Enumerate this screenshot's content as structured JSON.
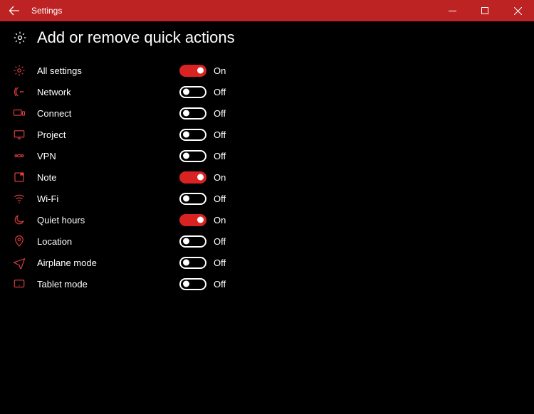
{
  "window": {
    "title": "Settings"
  },
  "page": {
    "title": "Add or remove quick actions"
  },
  "labels": {
    "on": "On",
    "off": "Off"
  },
  "actions": [
    {
      "id": "all-settings",
      "label": "All settings",
      "on": true
    },
    {
      "id": "network",
      "label": "Network",
      "on": false
    },
    {
      "id": "connect",
      "label": "Connect",
      "on": false
    },
    {
      "id": "project",
      "label": "Project",
      "on": false
    },
    {
      "id": "vpn",
      "label": "VPN",
      "on": false
    },
    {
      "id": "note",
      "label": "Note",
      "on": true
    },
    {
      "id": "wifi",
      "label": "Wi-Fi",
      "on": false
    },
    {
      "id": "quiet-hours",
      "label": "Quiet hours",
      "on": true
    },
    {
      "id": "location",
      "label": "Location",
      "on": false
    },
    {
      "id": "airplane-mode",
      "label": "Airplane mode",
      "on": false
    },
    {
      "id": "tablet-mode",
      "label": "Tablet mode",
      "on": false
    }
  ]
}
